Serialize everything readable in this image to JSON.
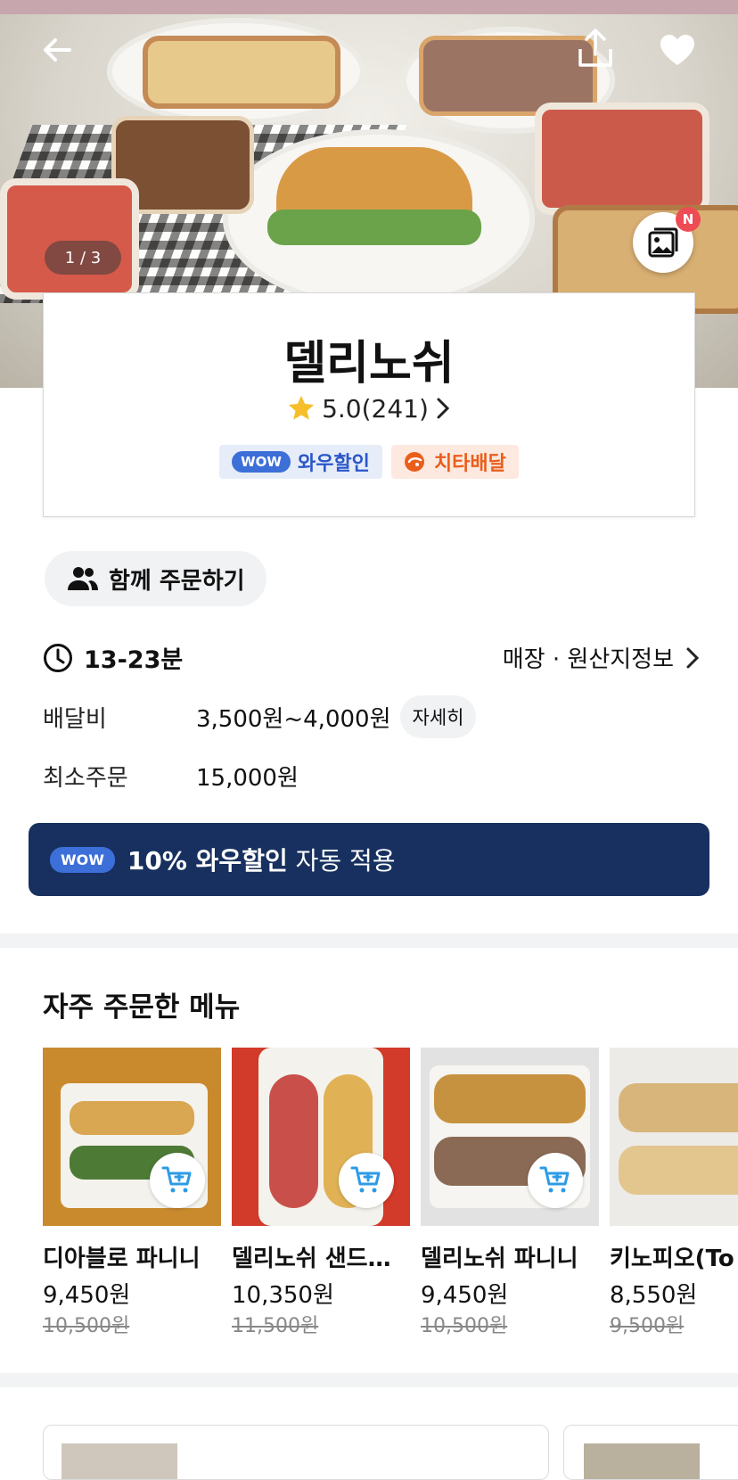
{
  "hero": {
    "counter": "1 / 3",
    "gallery_badge": "N"
  },
  "store": {
    "name": "델리노쉬",
    "rating": "5.0",
    "review_count": "(241)",
    "badges": {
      "wow_pill": "WOW",
      "wow_label": "와우할인",
      "cheetah_label": "치타배달"
    }
  },
  "together_order": "함께 주문하기",
  "delivery": {
    "time": "13-23분",
    "store_info_link": "매장 · 원산지정보",
    "fee_label": "배달비",
    "fee_value": "3,500원~4,000원",
    "fee_detail_button": "자세히",
    "min_order_label": "최소주문",
    "min_order_value": "15,000원"
  },
  "wow_banner": {
    "pill": "WOW",
    "highlight": "10% 와우할인",
    "rest": " 자동 적용"
  },
  "frequent_menu": {
    "title": "자주 주문한 메뉴",
    "items": [
      {
        "name": "디아블로 파니니",
        "price": "9,450원",
        "original_price": "10,500원"
      },
      {
        "name": "델리노쉬 샌드…",
        "price": "10,350원",
        "original_price": "11,500원"
      },
      {
        "name": "델리노쉬 파니니",
        "price": "9,450원",
        "original_price": "10,500원"
      },
      {
        "name": "키노피오(To",
        "price": "8,550원",
        "original_price": "9,500원"
      }
    ]
  },
  "colors": {
    "wow_blue": "#3d6fd8",
    "banner_navy": "#17305f",
    "cheetah_orange": "#ea5e1c",
    "cart_icon_blue": "#2c9be6",
    "badge_red": "#ef4b55",
    "star_yellow": "#f6be2a"
  },
  "icons": [
    "back-arrow-icon",
    "share-icon",
    "heart-icon",
    "gallery-icon",
    "star-icon",
    "chevron-right-icon",
    "people-icon",
    "clock-icon",
    "cart-add-icon",
    "cheetah-icon"
  ]
}
